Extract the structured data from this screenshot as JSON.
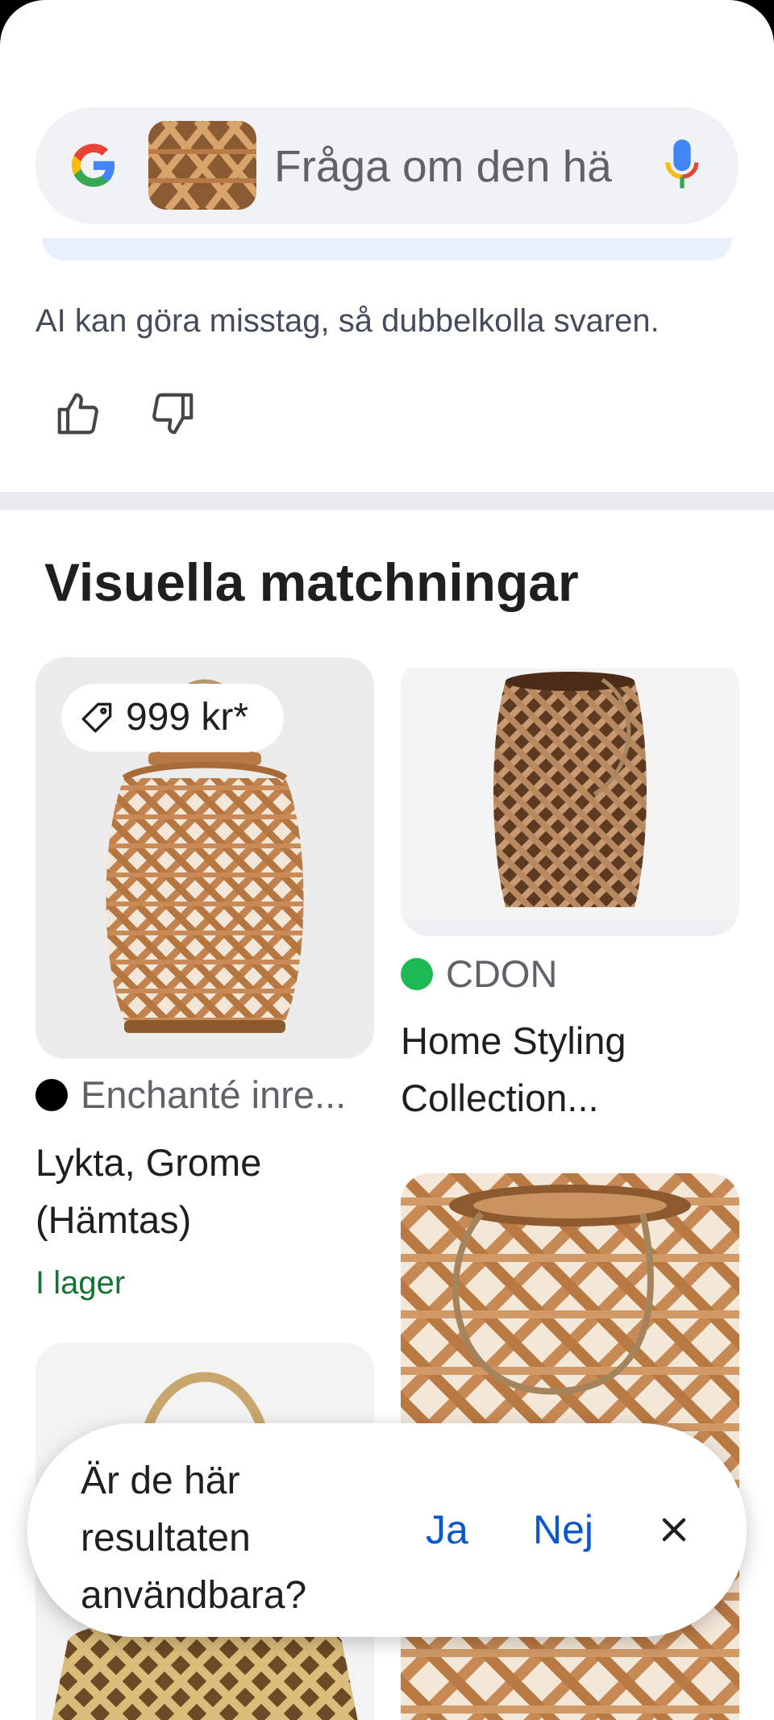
{
  "search": {
    "placeholder": "Fråga om den hä",
    "google_icon": "google-g-icon",
    "mic_icon": "microphone-icon"
  },
  "ai": {
    "disclaimer": "AI kan göra misstag, så dubbelkolla svaren.",
    "thumbs_up_icon": "thumbs-up-icon",
    "thumbs_down_icon": "thumbs-down-icon"
  },
  "visual_matches": {
    "title": "Visuella matchningar",
    "cards": [
      {
        "price": "999 kr*",
        "source": "Enchanté inre...",
        "title": "Lykta, Grome (Hämtas)",
        "stock": "I lager"
      },
      {
        "source": "CDON",
        "title": "Home Styling Collection..."
      }
    ]
  },
  "survey": {
    "question": "Är de här resultaten användbara?",
    "yes": "Ja",
    "no": "Nej"
  },
  "colors": {
    "accent_blue": "#0b57d0",
    "stock_green": "#137333",
    "search_bg": "#f0f2f5",
    "rattan": "#c98a57"
  }
}
